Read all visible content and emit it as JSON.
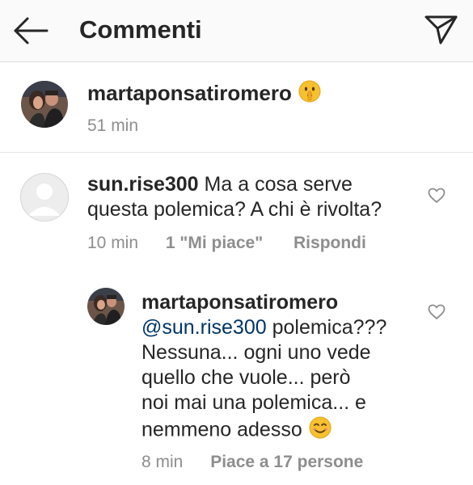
{
  "header": {
    "title": "Commenti"
  },
  "post": {
    "username": "martaponsatiromero",
    "time": "51 min"
  },
  "comments": [
    {
      "username": "sun.rise300",
      "text_line1": "Ma a cosa serve",
      "text_line2": "questa polemica? A chi è rivolta?",
      "time": "10 min",
      "likes": "1 \"Mi piace\"",
      "reply": "Rispondi"
    }
  ],
  "reply": {
    "username": "martaponsatiromero",
    "mention": "@sun.rise300",
    "text_line1_rest": " polemica???",
    "text_line2": "Nessuna... ogni uno vede",
    "text_line3": "quello che vuole... però",
    "text_line4": "noi mai una polemica... e",
    "text_line5": "nemmeno adesso",
    "time": "8 min",
    "likes": "Piace a 17 persone"
  },
  "icons": {
    "back": "arrow-left-icon",
    "send": "direct-send-icon",
    "like": "heart-outline-icon",
    "emoji_shush": "shushing-face-emoji",
    "emoji_smile": "smiling-face-emoji"
  }
}
